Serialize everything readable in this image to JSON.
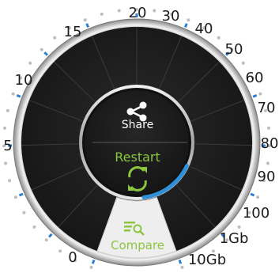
{
  "speedtest_dial": {
    "scale_labels": [
      "0",
      "5",
      "10",
      "15",
      "20",
      "30",
      "40",
      "50",
      "60",
      "70",
      "80",
      "90",
      "100",
      "1Gb",
      "10Gb"
    ],
    "share_label": "Share",
    "restart_label": "Restart",
    "compare_label": "Compare",
    "progress_fraction": 0.16,
    "colors": {
      "accent_green": "#8cc63f",
      "progress_blue": "#2f8fd8",
      "tick_blue": "#2a7fd0",
      "dial_dark": "#1b1b1b",
      "compare_panel": "#eeeeee"
    },
    "icons": {
      "share": "share-icon",
      "restart": "refresh-arrows-icon",
      "compare": "compare-list-search-icon"
    }
  }
}
